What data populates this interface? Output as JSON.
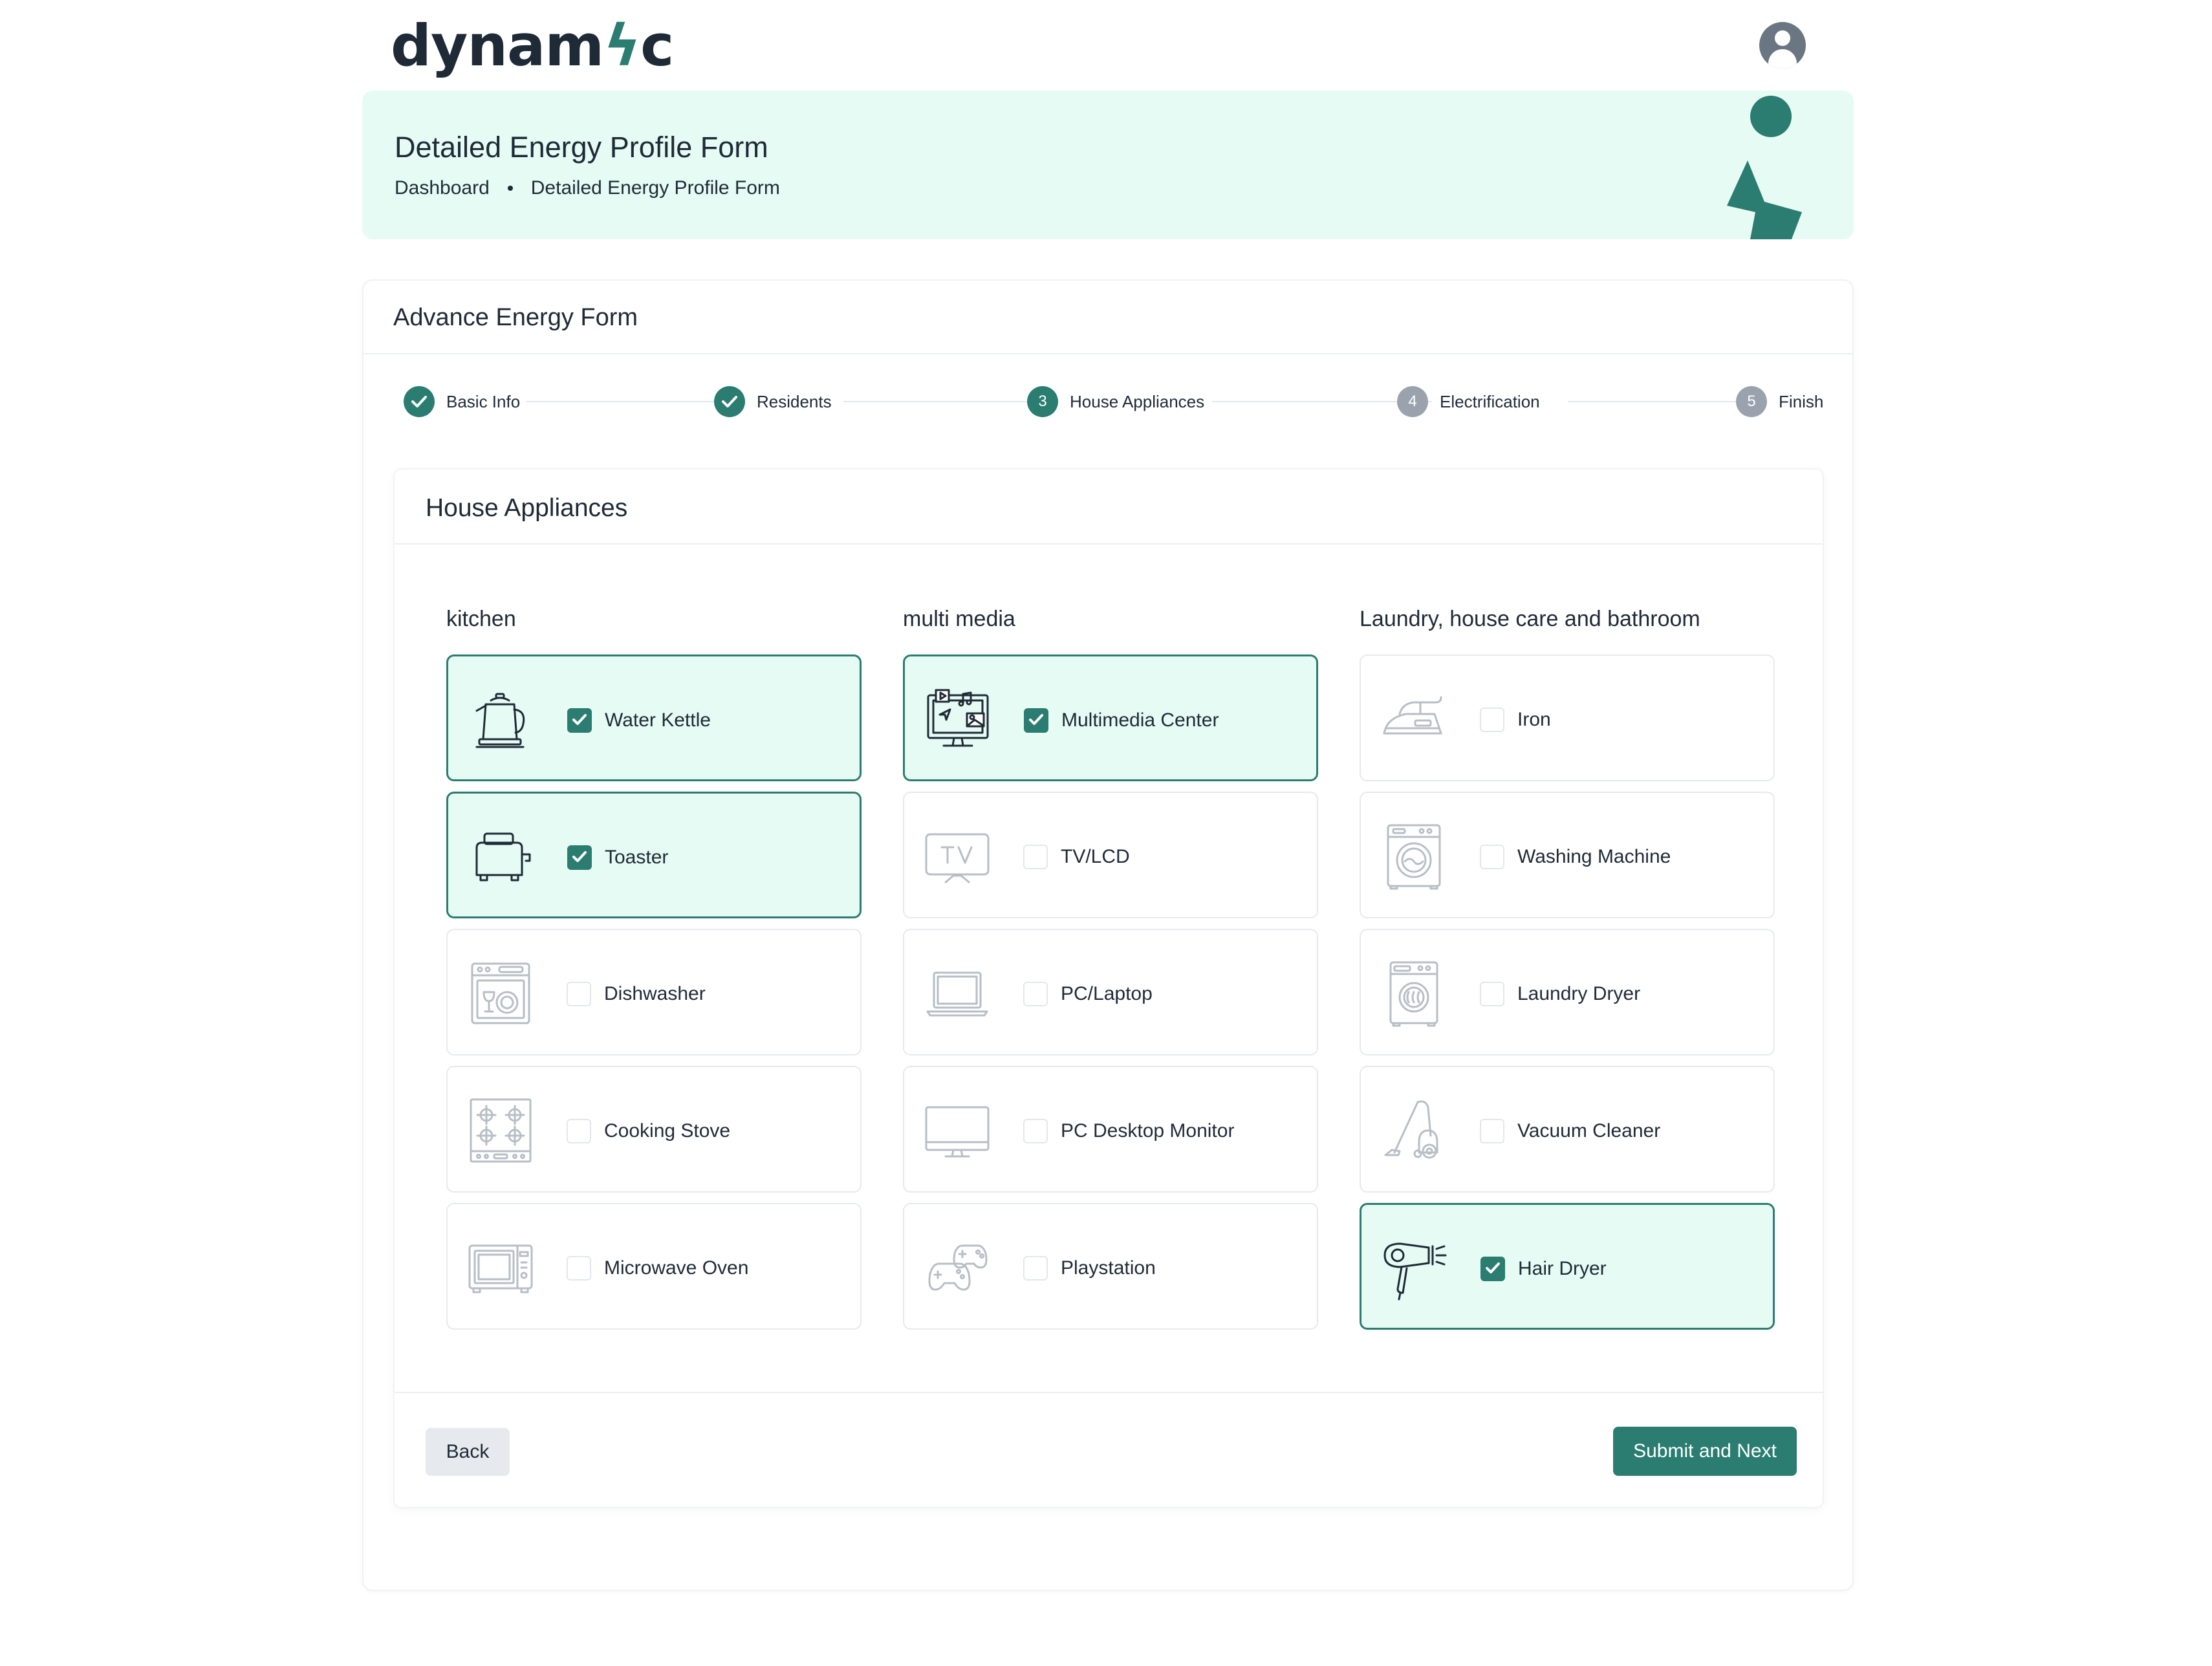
{
  "brand": {
    "logo_prefix": "dynam",
    "logo_bolt": "ϟ",
    "logo_suffix": "c",
    "accent": "#2a7d70",
    "banner_bg": "#e6fbf3"
  },
  "header": {
    "avatar_icon": "user-avatar-icon"
  },
  "banner": {
    "title": "Detailed Energy Profile Form",
    "breadcrumb": [
      "Dashboard",
      "Detailed Energy Profile Form"
    ]
  },
  "card": {
    "title": "Advance Energy Form"
  },
  "steps": [
    {
      "label": "Basic Info",
      "state": "done",
      "number": "1"
    },
    {
      "label": "Residents",
      "state": "done",
      "number": "2"
    },
    {
      "label": "House Appliances",
      "state": "active",
      "number": "3"
    },
    {
      "label": "Electrification",
      "state": "pending",
      "number": "4"
    },
    {
      "label": "Finish",
      "state": "pending",
      "number": "5"
    }
  ],
  "section": {
    "title": "House Appliances",
    "columns": [
      {
        "title": "kitchen",
        "items": [
          {
            "label": "Water Kettle",
            "checked": true,
            "icon": "kettle-icon"
          },
          {
            "label": "Toaster",
            "checked": true,
            "icon": "toaster-icon"
          },
          {
            "label": "Dishwasher",
            "checked": false,
            "icon": "dishwasher-icon"
          },
          {
            "label": "Cooking Stove",
            "checked": false,
            "icon": "stove-icon"
          },
          {
            "label": "Microwave Oven",
            "checked": false,
            "icon": "microwave-icon"
          }
        ]
      },
      {
        "title": "multi media",
        "items": [
          {
            "label": "Multimedia Center",
            "checked": true,
            "icon": "multimedia-icon"
          },
          {
            "label": "TV/LCD",
            "checked": false,
            "icon": "tv-icon"
          },
          {
            "label": "PC/Laptop",
            "checked": false,
            "icon": "laptop-icon"
          },
          {
            "label": "PC Desktop Monitor",
            "checked": false,
            "icon": "monitor-icon"
          },
          {
            "label": "Playstation",
            "checked": false,
            "icon": "gamepad-icon"
          }
        ]
      },
      {
        "title": "Laundry, house care and bathroom",
        "items": [
          {
            "label": "Iron",
            "checked": false,
            "icon": "iron-icon"
          },
          {
            "label": "Washing Machine",
            "checked": false,
            "icon": "washing-machine-icon"
          },
          {
            "label": "Laundry Dryer",
            "checked": false,
            "icon": "laundry-dryer-icon"
          },
          {
            "label": "Vacuum Cleaner",
            "checked": false,
            "icon": "vacuum-icon"
          },
          {
            "label": "Hair Dryer",
            "checked": true,
            "icon": "hair-dryer-icon"
          }
        ]
      }
    ]
  },
  "actions": {
    "back": "Back",
    "next": "Submit and Next"
  }
}
